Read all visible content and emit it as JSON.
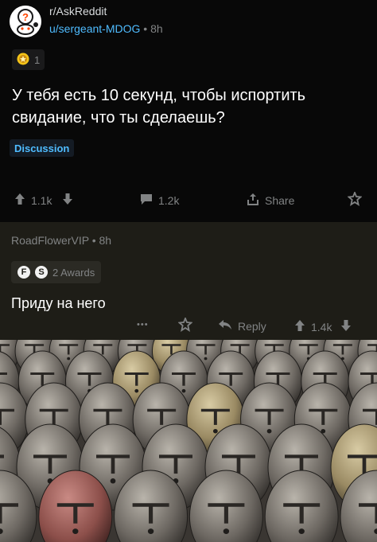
{
  "post": {
    "subreddit": "r/AskReddit",
    "author": "u/sergeant-MDOG",
    "separator": "•",
    "age": "8h",
    "award_count": "1",
    "title": "У тебя есть 10 секунд, чтобы испортить свидание, что ты сделаешь?",
    "flair": "Discussion",
    "upvotes": "1.1k",
    "comments": "1.2k",
    "share_label": "Share"
  },
  "comment": {
    "author": "RoadFlowerVIP",
    "separator": "•",
    "age": "8h",
    "awards_label": "2 Awards",
    "body": "Приду на него",
    "more": "•••",
    "reply_label": "Reply",
    "votes": "1.4k"
  },
  "colors": {
    "post_bg": "#080808",
    "comment_bg": "#1e1d17",
    "link_blue": "#4fbcff",
    "muted": "#818384"
  }
}
